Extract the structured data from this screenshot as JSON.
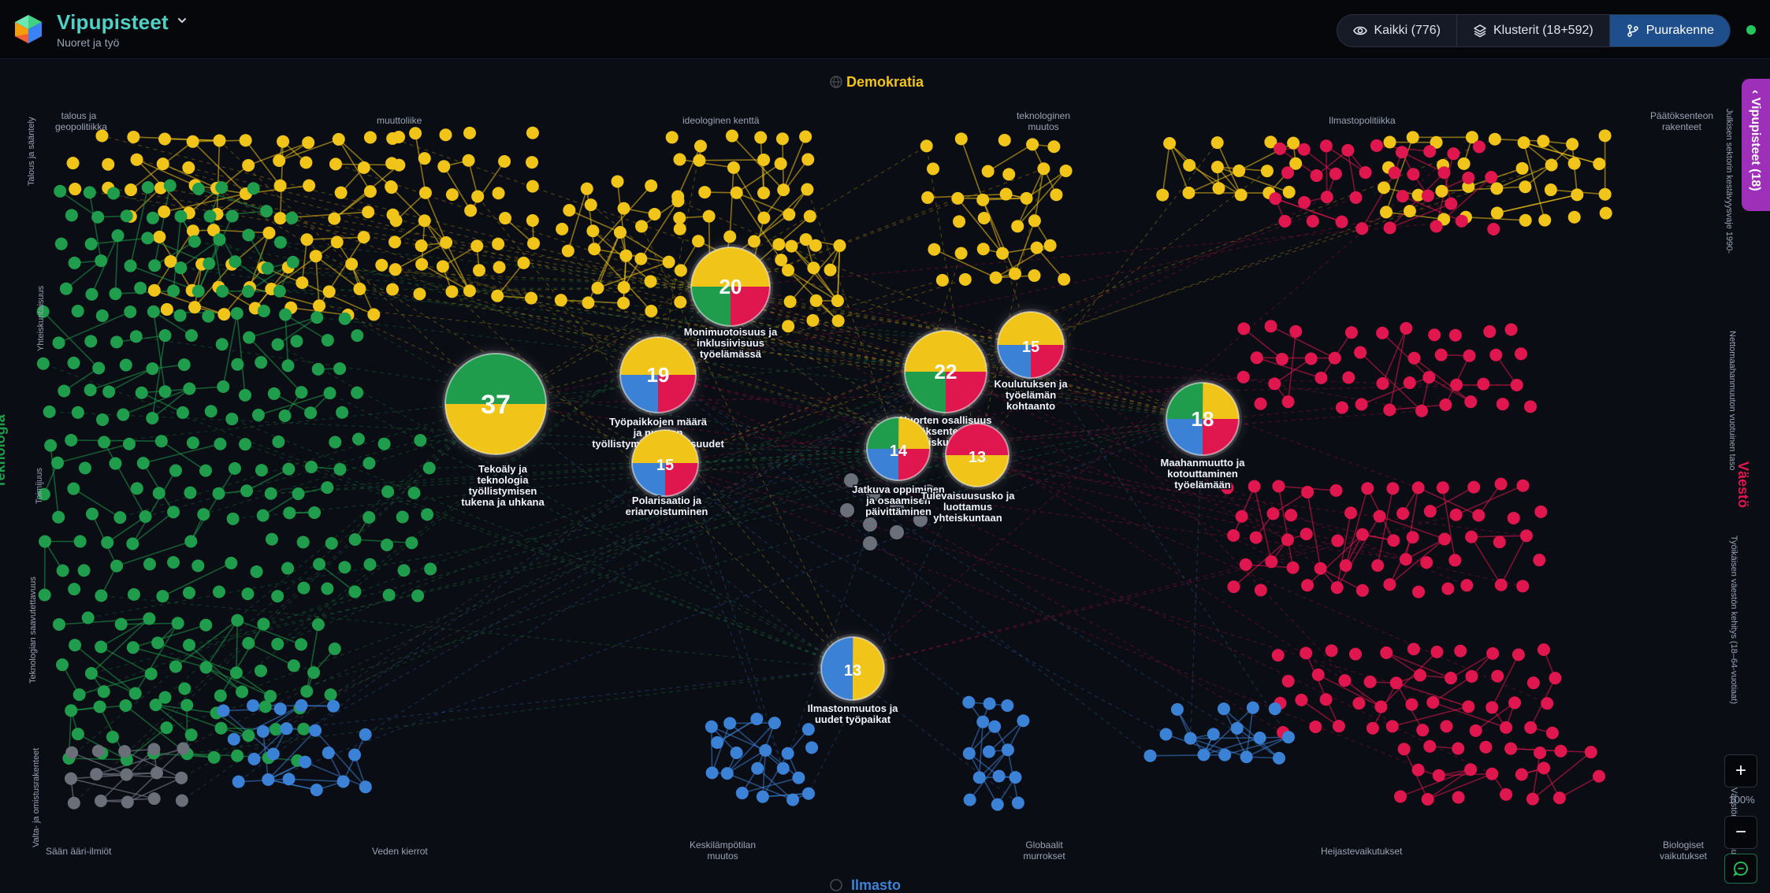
{
  "app": {
    "title": "Vipupisteet",
    "subtitle": "Nuoret ja työ"
  },
  "view_toggle": {
    "all_label": "Kaikki (776)",
    "clusters_label": "Klusterit (18+592)",
    "skeleton_label": "Puurakenne"
  },
  "side_panel": {
    "label": "Vipupisteet (18)"
  },
  "zoom": {
    "in": "+",
    "out": "−",
    "level": "100%"
  },
  "colors": {
    "democracy": "#f0c419",
    "technology": "#1f9d4c",
    "population": "#e0174f",
    "climate": "#3b82d6",
    "unassigned": "#6b6f7a",
    "accent": "#4fd1c5"
  },
  "regions": {
    "top": "Demokratia",
    "left": "Teknologia",
    "right": "Väestö",
    "bottom": "Ilmasto"
  },
  "top_labels": [
    "talous ja geopolitiikka",
    "muuttoliike",
    "ideologinen kenttä",
    "teknologinen muutos",
    "Ilmastopolitiikka",
    "Päätöksenteon rakenteet"
  ],
  "bottom_labels": [
    "Sään ääri-ilmiöt",
    "Veden kierrot",
    "Keskilämpötilan muutos",
    "Globaalit murrokset",
    "Heijastevaikutukset",
    "Biologiset vaikutukset"
  ],
  "left_labels": [
    "Talous ja sääntely",
    "Yhteiskuntaisuus",
    "Toimijuus",
    "Teknologian saavutettavuus",
    "Valta- ja omistusrakenteet"
  ],
  "right_labels": [
    "Julkisen sektorin kestävyysvaje 1990-",
    "Nettomaahanmuuton vuotuinen taso",
    "Työikäisen väestön kehitys (18–64-vuotiaat)",
    "Väestön huoltosuhde"
  ],
  "hubs": [
    {
      "count": "37",
      "label": [
        "Tekoäly ja",
        "teknologia",
        "työllistymisen",
        "tukena ja uhkana"
      ]
    },
    {
      "count": "20",
      "label": [
        "Monimuotoisuus ja",
        "inklusiivisuus",
        "työelämässä"
      ]
    },
    {
      "count": "19",
      "label": [
        "Työpaikkojen määrä",
        "ja nuorten",
        "työllistymismahdollisuudet"
      ]
    },
    {
      "count": "22",
      "label": [
        "Nuorten osallisuus",
        "päätöksenteossa ja",
        "yhteiskunnassa"
      ]
    },
    {
      "count": "15",
      "label": [
        "Koulutuksen ja",
        "työelämän",
        "kohtaanto"
      ]
    },
    {
      "count": "18",
      "label": [
        "Maahanmuutto ja",
        "kotouttaminen",
        "työelämään"
      ]
    },
    {
      "count": "15",
      "label": [
        "Polarisaatio ja",
        "eriarvoistuminen"
      ]
    },
    {
      "count": "14",
      "label": [
        "Jatkuva oppiminen",
        "ja osaamisen",
        "päivittäminen"
      ]
    },
    {
      "count": "13",
      "label": [
        "Tulevaisuususko ja",
        "luottamus",
        "yhteiskuntaan"
      ]
    },
    {
      "count": "13",
      "label": [
        "Ilmastonmuutos ja",
        "uudet työpaikat"
      ]
    }
  ]
}
